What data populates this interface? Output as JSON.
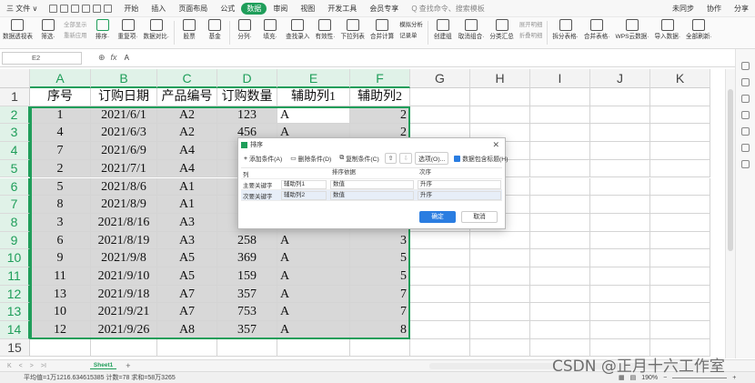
{
  "menubar": {
    "file": "三 文件 ∨",
    "tabs": [
      "开始",
      "插入",
      "页面布局",
      "公式",
      "数据",
      "审阅",
      "视图",
      "开发工具",
      "会员专享"
    ],
    "active_tab": "数据",
    "search": "Q 查找命令、搜索模板",
    "right": [
      "未同步",
      "协作",
      "分享"
    ]
  },
  "toolbar": {
    "items": [
      {
        "label": "数据透视表",
        "icon": "pivot-table-icon"
      },
      {
        "label": "筛选·",
        "icon": "filter-icon"
      },
      {
        "label": "排序·",
        "icon": "sort-icon"
      },
      {
        "label": "重复项·",
        "icon": "duplicate-icon"
      },
      {
        "label": "数据对比·",
        "icon": "compare-icon"
      },
      {
        "label": "股票",
        "icon": "stock-icon"
      },
      {
        "label": "基金",
        "icon": "fund-icon"
      },
      {
        "label": "分列·",
        "icon": "split-column-icon"
      },
      {
        "label": "填充·",
        "icon": "fill-icon"
      },
      {
        "label": "查找录入",
        "icon": "lookup-icon"
      },
      {
        "label": "有效性·",
        "icon": "validation-icon"
      },
      {
        "label": "下拉列表",
        "icon": "dropdown-list-icon"
      },
      {
        "label": "合并计算",
        "icon": "consolidate-icon"
      },
      {
        "label": "创建组",
        "icon": "group-icon"
      },
      {
        "label": "取消组合·",
        "icon": "ungroup-icon"
      },
      {
        "label": "分类汇总",
        "icon": "subtotal-icon"
      },
      {
        "label": "拆分表格·",
        "icon": "split-table-icon"
      },
      {
        "label": "合并表格·",
        "icon": "merge-table-icon"
      },
      {
        "label": "WPS云数据·",
        "icon": "cloud-data-icon"
      },
      {
        "label": "导入数据·",
        "icon": "import-icon"
      },
      {
        "label": "全部刷新·",
        "icon": "refresh-icon"
      }
    ],
    "small": {
      "show_all": "全部显示",
      "reapply": "重新应用",
      "whatif": "模拟分析",
      "record": "记录单",
      "expand": "展开明细",
      "collapse": "折叠明细"
    }
  },
  "formula_bar": {
    "cell_ref": "E2",
    "value": "A"
  },
  "sheet": {
    "columns": [
      "A",
      "B",
      "C",
      "D",
      "E",
      "F",
      "G",
      "H",
      "I",
      "J",
      "K"
    ],
    "rows": [
      "1",
      "2",
      "3",
      "4",
      "5",
      "6",
      "7",
      "8",
      "9",
      "10",
      "11",
      "12",
      "13",
      "14",
      "15"
    ],
    "headers": [
      "序号",
      "订购日期",
      "产品编号",
      "订购数量",
      "辅助列1",
      "辅助列2"
    ],
    "data": [
      [
        "1",
        "2021/6/1",
        "A2",
        "123",
        "A",
        "2"
      ],
      [
        "4",
        "2021/6/3",
        "A2",
        "456",
        "A",
        "2"
      ],
      [
        "7",
        "2021/6/9",
        "A4",
        "",
        "",
        ""
      ],
      [
        "2",
        "2021/7/1",
        "A4",
        "",
        "",
        ""
      ],
      [
        "5",
        "2021/8/6",
        "A1",
        "",
        "",
        ""
      ],
      [
        "8",
        "2021/8/9",
        "A1",
        "",
        "",
        ""
      ],
      [
        "3",
        "2021/8/16",
        "A3",
        "",
        "",
        ""
      ],
      [
        "6",
        "2021/8/19",
        "A3",
        "258",
        "A",
        "3"
      ],
      [
        "9",
        "2021/9/8",
        "A5",
        "369",
        "A",
        "5"
      ],
      [
        "11",
        "2021/9/10",
        "A5",
        "159",
        "A",
        "5"
      ],
      [
        "13",
        "2021/9/18",
        "A7",
        "357",
        "A",
        "7"
      ],
      [
        "10",
        "2021/9/21",
        "A7",
        "753",
        "A",
        "7"
      ],
      [
        "12",
        "2021/9/26",
        "A8",
        "357",
        "A",
        "8"
      ]
    ]
  },
  "dialog": {
    "title": "排序",
    "add": "添加条件(A)",
    "delete": "删除条件(D)",
    "copy": "复制条件(C)",
    "options": "选项(O)...",
    "has_header": "数据包含标题(H)",
    "col_header": "列",
    "basis_header": "排序依据",
    "order_header": "次序",
    "rows": [
      {
        "key": "主要关键字",
        "column": "辅助列1",
        "basis": "数值",
        "order": "升序"
      },
      {
        "key": "次要关键字",
        "column": "辅助列2",
        "basis": "数值",
        "order": "升序"
      }
    ],
    "ok": "确定",
    "cancel": "取消"
  },
  "sheetbar": {
    "tab": "Sheet1",
    "add": "+"
  },
  "status": {
    "stats": "平均值=1万1216.634615385 计数=78 求和=58万3265",
    "zoom": "190%"
  },
  "watermark": "CSDN @正月十六工作室"
}
